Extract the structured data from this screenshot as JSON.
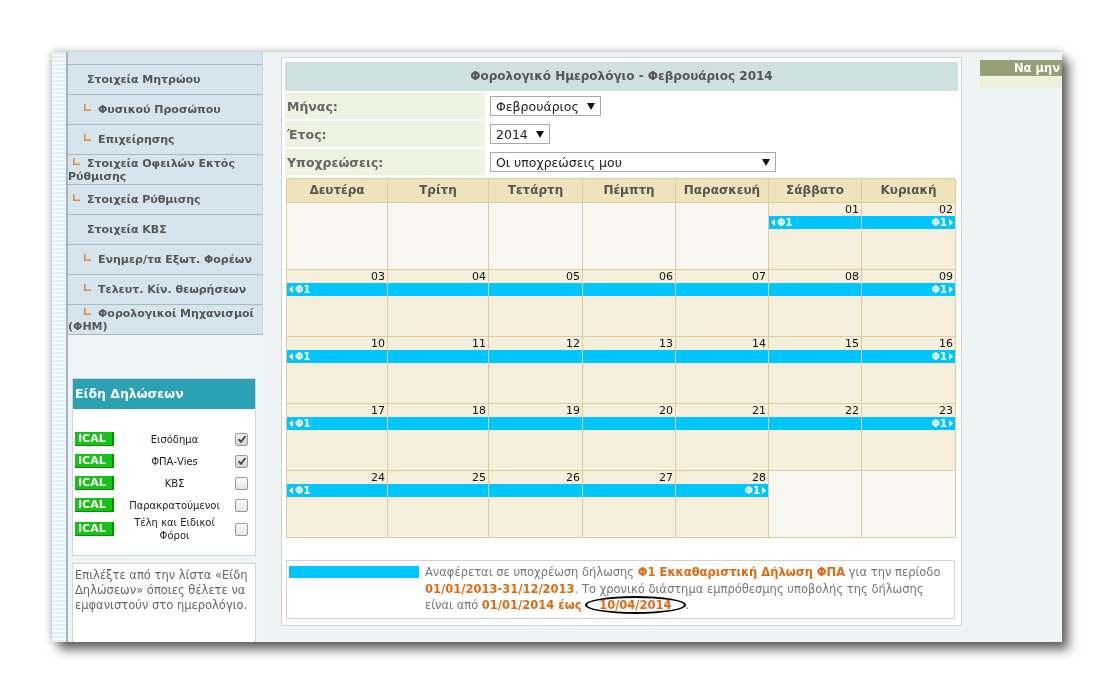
{
  "sidebar": {
    "menu": [
      {
        "label": "Στοιχεία Μητρώου",
        "children": [
          {
            "label": "Φυσικού Προσώπου",
            "kind": "indented"
          },
          {
            "label": "Επιχείρησης",
            "kind": "indented"
          },
          {
            "label": "Στοιχεία Οφειλών Εκτός Ρύθμισης",
            "kind": "outdented"
          },
          {
            "label": "Στοιχεία Ρύθμισης",
            "kind": "outdented"
          }
        ]
      },
      {
        "label": "Στοιχεία ΚΒΣ",
        "children": [
          {
            "label": "Ενημερ/τα Εξωτ. Φορέων",
            "kind": "indented"
          },
          {
            "label": "Τελευτ. Κίν. θεωρήσεων",
            "kind": "indented"
          },
          {
            "label": "Φορολογικοί Μηχανισμοί (ΦΗΜ)",
            "kind": "indented"
          }
        ]
      }
    ],
    "declaration_types": {
      "title": "Είδη Δηλώσεων",
      "items": [
        {
          "badge": "ICAL",
          "label": "Εισόδημα",
          "checked": true
        },
        {
          "badge": "ICAL",
          "label": "ΦΠΑ-Vies",
          "checked": true
        },
        {
          "badge": "ICAL",
          "label": "ΚΒΣ",
          "checked": false
        },
        {
          "badge": "ICAL",
          "label": "Παρακρατούμενοι",
          "checked": false
        },
        {
          "badge": "ICAL",
          "label": "Τέλη και Ειδικοί Φόροι",
          "checked": false
        }
      ]
    },
    "hint": "Επιλέξτε από την λίστα «Είδη Δηλώσεων» όποιες θέλετε να εμφανιστούν στο ημερολόγιο."
  },
  "calendar_panel": {
    "title": "Φορολογικό Ημερολόγιο - Φεβρουάριος 2014",
    "filters": [
      {
        "label": "Μήνας:",
        "value": "Φεβρουάριος",
        "kind": "compact"
      },
      {
        "label": "Έτος:",
        "value": "2014",
        "kind": "compact"
      },
      {
        "label": "Υποχρεώσεις:",
        "value": "Οι υποχρεώσεις μου",
        "kind": "wide"
      }
    ],
    "calendar": {
      "columns": [
        "Δευτέρα",
        "Τρίτη",
        "Τετάρτη",
        "Πέμπτη",
        "Παρασκευή",
        "Σάββατο",
        "Κυριακή"
      ],
      "weeks": [
        {
          "days": [
            {
              "in_month": false,
              "kind": "blank"
            },
            {
              "in_month": false,
              "kind": "blank"
            },
            {
              "in_month": false,
              "kind": "blank"
            },
            {
              "in_month": false,
              "kind": "blank"
            },
            {
              "in_month": false,
              "kind": "blank"
            },
            {
              "day": "01",
              "in_month": true,
              "kind": "start",
              "bar_label": "Φ1"
            },
            {
              "day": "02",
              "in_month": true,
              "kind": "end",
              "bar_label": "Φ1"
            }
          ]
        },
        {
          "days": [
            {
              "day": "03",
              "in_month": true,
              "kind": "start",
              "bar_label": "Φ1"
            },
            {
              "day": "04",
              "in_month": true,
              "kind": "middle"
            },
            {
              "day": "05",
              "in_month": true,
              "kind": "middle"
            },
            {
              "day": "06",
              "in_month": true,
              "kind": "middle"
            },
            {
              "day": "07",
              "in_month": true,
              "kind": "middle"
            },
            {
              "day": "08",
              "in_month": true,
              "kind": "middle"
            },
            {
              "day": "09",
              "in_month": true,
              "kind": "end",
              "bar_label": "Φ1"
            }
          ]
        },
        {
          "days": [
            {
              "day": "10",
              "in_month": true,
              "kind": "start",
              "bar_label": "Φ1"
            },
            {
              "day": "11",
              "in_month": true,
              "kind": "middle"
            },
            {
              "day": "12",
              "in_month": true,
              "kind": "middle"
            },
            {
              "day": "13",
              "in_month": true,
              "kind": "middle"
            },
            {
              "day": "14",
              "in_month": true,
              "kind": "middle"
            },
            {
              "day": "15",
              "in_month": true,
              "kind": "middle"
            },
            {
              "day": "16",
              "in_month": true,
              "kind": "end",
              "bar_label": "Φ1"
            }
          ]
        },
        {
          "days": [
            {
              "day": "17",
              "in_month": true,
              "kind": "start",
              "bar_label": "Φ1"
            },
            {
              "day": "18",
              "in_month": true,
              "kind": "middle"
            },
            {
              "day": "19",
              "in_month": true,
              "kind": "middle"
            },
            {
              "day": "20",
              "in_month": true,
              "kind": "middle"
            },
            {
              "day": "21",
              "in_month": true,
              "kind": "middle"
            },
            {
              "day": "22",
              "in_month": true,
              "kind": "middle"
            },
            {
              "day": "23",
              "in_month": true,
              "kind": "end",
              "bar_label": "Φ1"
            }
          ]
        },
        {
          "days": [
            {
              "day": "24",
              "in_month": true,
              "kind": "start",
              "bar_label": "Φ1"
            },
            {
              "day": "25",
              "in_month": true,
              "kind": "middle"
            },
            {
              "day": "26",
              "in_month": true,
              "kind": "middle"
            },
            {
              "day": "27",
              "in_month": true,
              "kind": "middle"
            },
            {
              "day": "28",
              "in_month": true,
              "kind": "end",
              "bar_label": "Φ1"
            },
            {
              "in_month": false,
              "kind": "blank"
            },
            {
              "in_month": false,
              "kind": "blank"
            }
          ]
        }
      ]
    },
    "legend": {
      "color": "#00c6ff",
      "text": "Αναφέρεται σε υποχρέωση δήλωσης **Φ1 Εκκαθαριστική Δήλωση ΦΠΑ** για την περίοδο **01/01/2013-31/12/2013**. Το χρονικό διάστημα εμπρόθεσμης υποβολής της δήλωσης είναι από **01/01/2014 έως** **10/04/2014**.",
      "annotations": [
        {
          "kind": "ellipse"
        }
      ]
    }
  },
  "side_panel": {
    "title": "Να μην"
  }
}
